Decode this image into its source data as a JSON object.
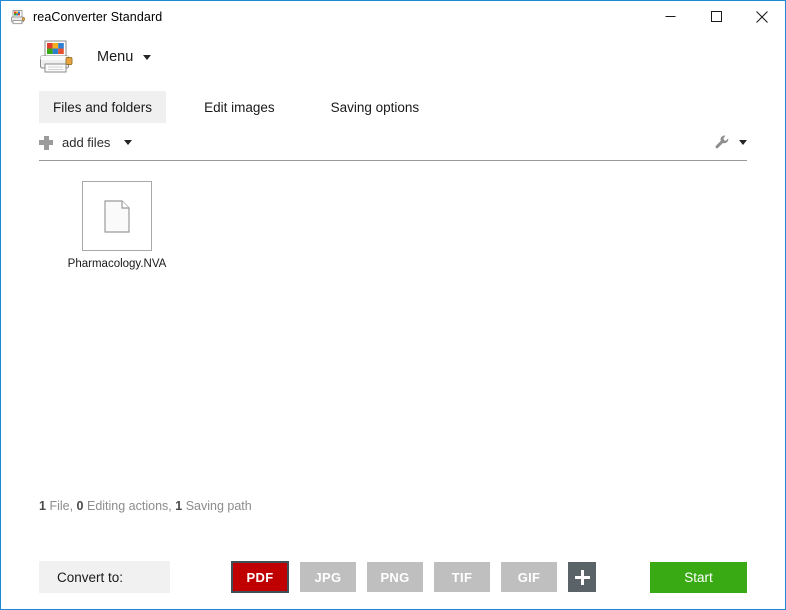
{
  "window": {
    "title": "reaConverter Standard",
    "icon": "printer-converter-icon",
    "controls": {
      "minimize": "minimize-icon",
      "maximize": "maximize-icon",
      "close": "close-icon"
    },
    "border_color": "#1c8ad4"
  },
  "menu": {
    "logo": "printer-converter-logo",
    "label": "Menu",
    "caret": "chevron-down-icon"
  },
  "tabs": [
    {
      "label": "Files and folders",
      "active": true
    },
    {
      "label": "Edit images",
      "active": false
    },
    {
      "label": "Saving options",
      "active": false
    }
  ],
  "toolbar": {
    "add_files_label": "add files",
    "add_files_icon": "plus-icon",
    "add_files_caret": "chevron-down-icon",
    "settings_icon": "wrench-icon",
    "settings_caret": "chevron-down-icon"
  },
  "files": [
    {
      "name": "Pharmacology.NVA",
      "thumbnail": "generic-document-icon"
    }
  ],
  "status": {
    "files_count": "1",
    "files_label": "File,",
    "actions_count": "0",
    "actions_label": "Editing actions,",
    "paths_count": "1",
    "paths_label": "Saving path"
  },
  "bottom": {
    "convert_to_label": "Convert to:",
    "formats": [
      {
        "label": "PDF",
        "selected": true,
        "color": "#c00000"
      },
      {
        "label": "JPG",
        "selected": false,
        "color": "#bfbfbf"
      },
      {
        "label": "PNG",
        "selected": false,
        "color": "#bfbfbf"
      },
      {
        "label": "TIF",
        "selected": false,
        "color": "#bfbfbf"
      },
      {
        "label": "GIF",
        "selected": false,
        "color": "#bfbfbf"
      }
    ],
    "add_format_icon": "plus-icon",
    "start_label": "Start",
    "start_color": "#3aaa14"
  }
}
